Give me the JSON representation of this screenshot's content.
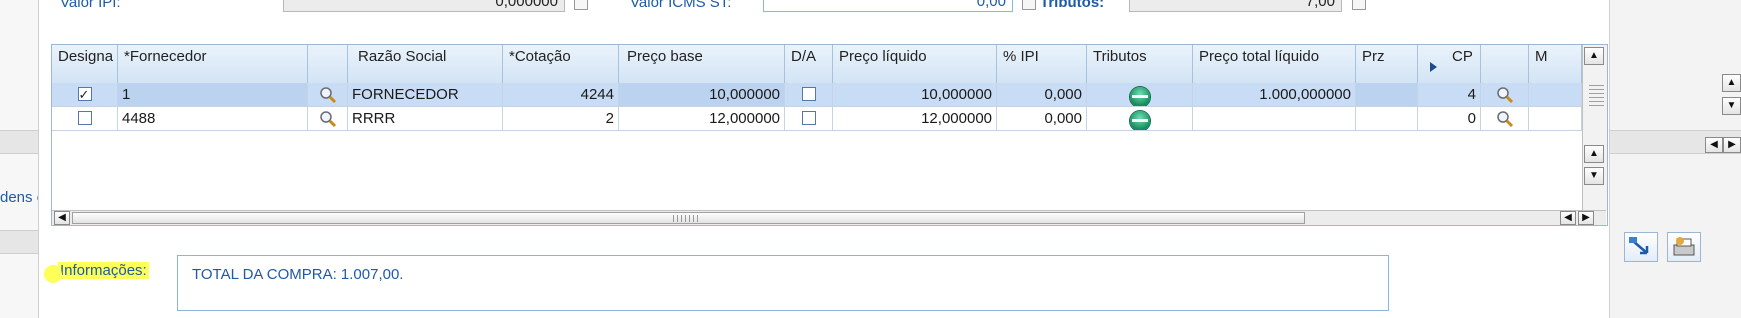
{
  "top_form": {
    "valor_ipi_label": "Valor IPI:",
    "valor_ipi_value": "0,000000",
    "valor_icms_st_label": "Valor ICMS ST:",
    "valor_icms_st_value": "0,00",
    "tributos_label": "Tributos:",
    "tributos_value": "7,00"
  },
  "left_fragment_text": "dens o",
  "grid": {
    "columns": [
      "Designa",
      "*Fornecedor",
      "",
      "Razão Social",
      "*Cotação",
      "Preço base",
      "D/A",
      "Preço líquido",
      "% IPI",
      "Tributos",
      "Preço total líquido",
      "Prz",
      "CP",
      "",
      "M"
    ],
    "rows": [
      {
        "designa_checked": true,
        "fornecedor": "1",
        "razao_social": "FORNECEDOR",
        "cotacao": "4244",
        "preco_base": "10,000000",
        "da_checked": false,
        "preco_liquido": "10,000000",
        "pct_ipi": "0,000",
        "preco_total_liquido": "1.000,000000",
        "prz": "",
        "cp": "4",
        "selected": true
      },
      {
        "designa_checked": false,
        "fornecedor": "4488",
        "razao_social": "RRRR",
        "cotacao": "2",
        "preco_base": "12,000000",
        "da_checked": false,
        "preco_liquido": "12,000000",
        "pct_ipi": "0,000",
        "preco_total_liquido": "",
        "prz": "",
        "cp": "0",
        "selected": false
      }
    ]
  },
  "info": {
    "label": "Informações:",
    "text": "TOTAL DA COMPRA: 1.007,00."
  },
  "icons": {
    "lookup": "magnifier-icon",
    "tributos": "green-status-ball-icon"
  },
  "colors": {
    "label_blue": "#1e5aa8",
    "header_bg": "#d3e4f5",
    "selected_row": "#c8dcf5",
    "highlight": "#ffff5a"
  }
}
